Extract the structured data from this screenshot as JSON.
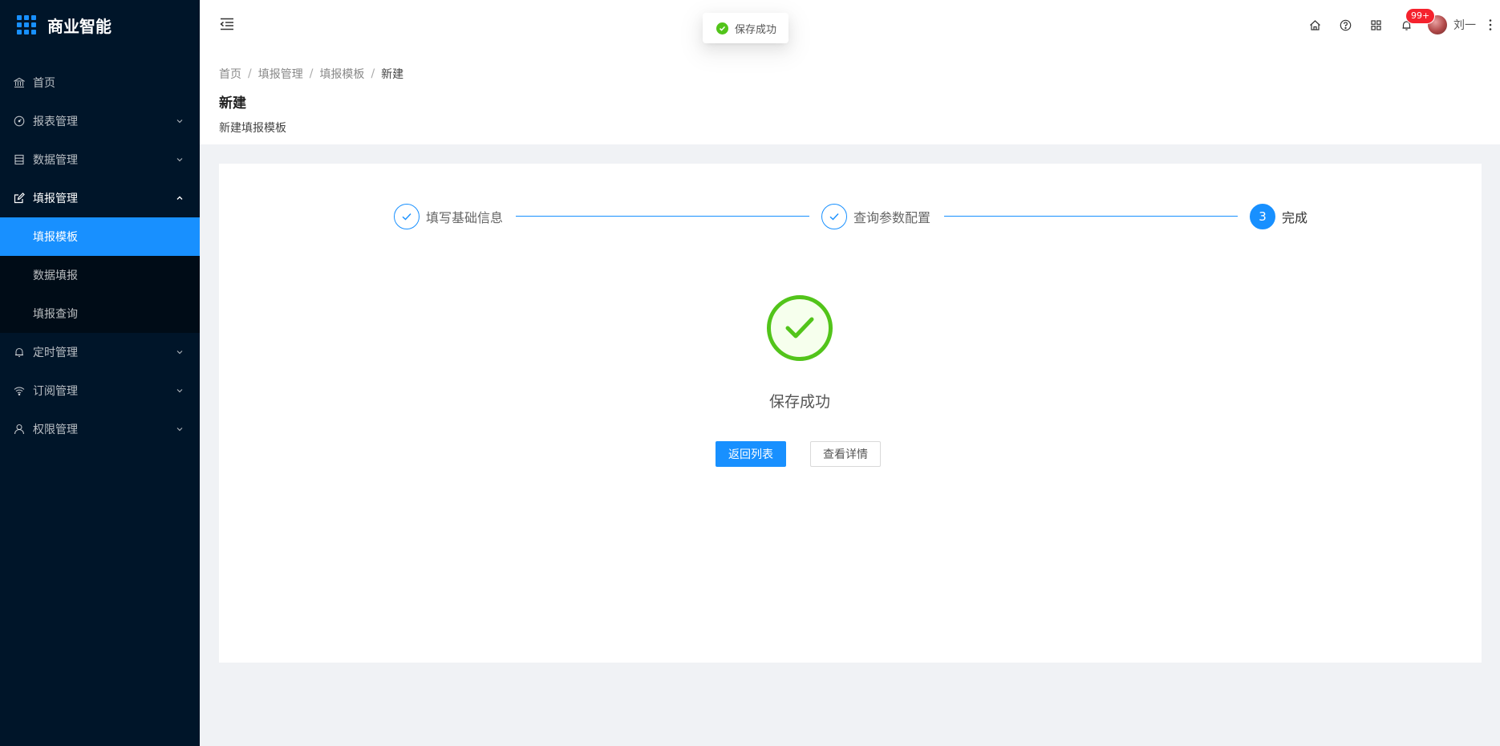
{
  "app": {
    "title": "商业智能",
    "brand_color": "#1890ff"
  },
  "sidebar": {
    "items": [
      {
        "label": "首页",
        "icon": "bank-icon"
      },
      {
        "label": "报表管理",
        "icon": "dashboard-icon"
      },
      {
        "label": "数据管理",
        "icon": "database-icon"
      },
      {
        "label": "填报管理",
        "icon": "form-edit-icon",
        "expanded": true,
        "children": [
          {
            "label": "填报模板",
            "active": true
          },
          {
            "label": "数据填报"
          },
          {
            "label": "填报查询"
          }
        ]
      },
      {
        "label": "定时管理",
        "icon": "bell-icon"
      },
      {
        "label": "订阅管理",
        "icon": "wifi-icon"
      },
      {
        "label": "权限管理",
        "icon": "user-icon"
      }
    ]
  },
  "header": {
    "notification_count": "99+",
    "user_name": "刘一"
  },
  "toast": {
    "message": "保存成功",
    "type": "success"
  },
  "page_header": {
    "breadcrumb": [
      "首页",
      "填报管理",
      "填报模板",
      "新建"
    ],
    "title": "新建",
    "description": "新建填报模板"
  },
  "steps": [
    {
      "title": "填写基础信息",
      "status": "finished"
    },
    {
      "title": "查询参数配置",
      "status": "finished"
    },
    {
      "title": "完成",
      "status": "current",
      "number": "3"
    }
  ],
  "result": {
    "title": "保存成功",
    "status_color": "#52c41a",
    "primary_button": "返回列表",
    "secondary_button": "查看详情"
  }
}
